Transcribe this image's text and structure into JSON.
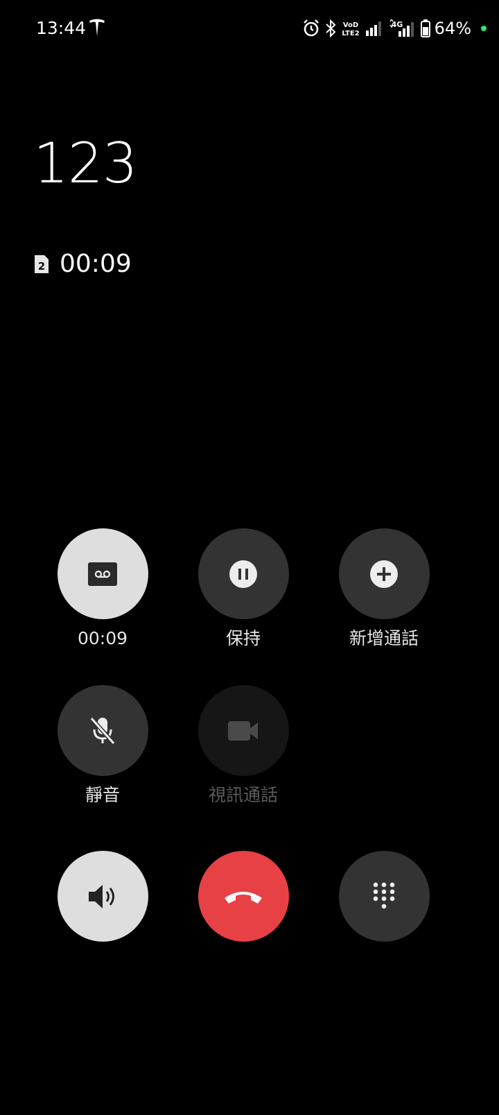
{
  "status_bar": {
    "time": "13:44",
    "battery": "64%",
    "volte_label": "VoD LTE2",
    "network_label": "4G",
    "charge_dot_color": "#2ee57a"
  },
  "call": {
    "number": "123",
    "sim_slot": "2",
    "duration": "00:09"
  },
  "actions": {
    "record": {
      "label": "00:09",
      "icon": "record-icon",
      "state": "active"
    },
    "hold": {
      "label": "保持",
      "icon": "pause-icon"
    },
    "add_call": {
      "label": "新增通話",
      "icon": "add-call-icon"
    },
    "mute": {
      "label": "靜音",
      "icon": "mic-off-icon"
    },
    "video_call": {
      "label": "視訊通話",
      "icon": "video-icon",
      "state": "disabled"
    },
    "speaker": {
      "icon": "speaker-icon",
      "state": "active"
    },
    "end_call": {
      "icon": "hang-up-icon",
      "color": "#e74045"
    },
    "keypad": {
      "icon": "dialpad-icon"
    }
  }
}
